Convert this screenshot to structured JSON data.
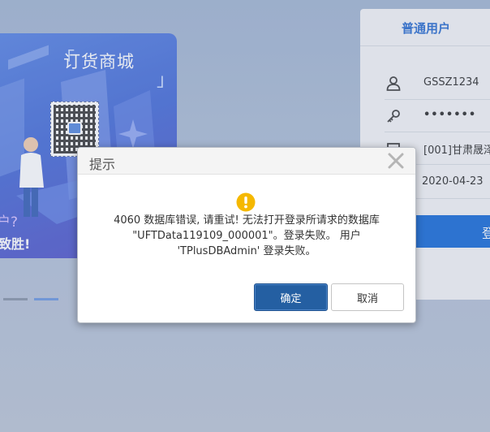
{
  "banner": {
    "title": "订货商城",
    "bracket_left": "「",
    "bracket_right": "」",
    "tagline_1": "户?",
    "tagline_2": "致胜!"
  },
  "login": {
    "tab_label": "普通用户",
    "username": "GSSZ1234",
    "password": "•••••••",
    "account_set": "[001]甘肃晟泽",
    "login_date": "2020-04-23",
    "login_button": "登"
  },
  "dialog": {
    "title": "提示",
    "message_line1": "4060 数据库错误, 请重试! 无法打开登录所请求的数据库",
    "message_line2": "\"UFTData119109_000001\"。登录失败。 用户",
    "message_line3": "'TPlusDBAdmin' 登录失败。",
    "ok_label": "确定",
    "cancel_label": "取消"
  },
  "colors": {
    "accent": "#1d6ed8",
    "ok_button": "#245fa2",
    "warning": "#f5b800"
  },
  "icons": {
    "close": "close-icon",
    "warning": "warning-icon",
    "user": "user-icon",
    "password": "key-icon",
    "account": "account-set-icon"
  }
}
